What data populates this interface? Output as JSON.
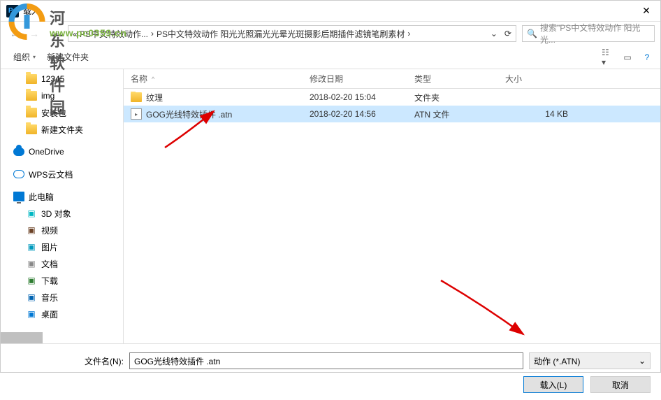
{
  "title": "载入",
  "breadcrumb": {
    "seg1": "« PS中文特效动作...",
    "seg2": "PS中文特效动作 阳光光照漏光光晕光斑摄影后期插件滤镜笔刷素材"
  },
  "search": {
    "placeholder": "搜索\"PS中文特效动作 阳光光..."
  },
  "toolbar": {
    "organize": "组织",
    "newfolder": "新建文件夹"
  },
  "sidebar": {
    "folders": [
      "12345",
      "img",
      "安装包",
      "新建文件夹"
    ],
    "onedrive": "OneDrive",
    "wps": "WPS云文档",
    "thispc": "此电脑",
    "pc": [
      {
        "label": "3D 对象",
        "color": "#00b7c3"
      },
      {
        "label": "视频",
        "color": "#6b4226"
      },
      {
        "label": "图片",
        "color": "#0099bc"
      },
      {
        "label": "文档",
        "color": "#888"
      },
      {
        "label": "下载",
        "color": "#2e7d32"
      },
      {
        "label": "音乐",
        "color": "#0063b1"
      },
      {
        "label": "桌面",
        "color": "#0078d4"
      }
    ]
  },
  "columns": {
    "name": "名称",
    "date": "修改日期",
    "type": "类型",
    "size": "大小"
  },
  "rows": [
    {
      "name": "纹理",
      "date": "2018-02-20 15:04",
      "type": "文件夹",
      "size": "",
      "icon": "folder",
      "selected": false
    },
    {
      "name": "GOG光线特效插件 .atn",
      "date": "2018-02-20 14:56",
      "type": "ATN 文件",
      "size": "14 KB",
      "icon": "atn",
      "selected": true
    }
  ],
  "footer": {
    "label": "文件名(N):",
    "value": "GOG光线特效插件 .atn",
    "filter": "动作 (*.ATN)",
    "load": "载入(L)",
    "cancel": "取消"
  }
}
